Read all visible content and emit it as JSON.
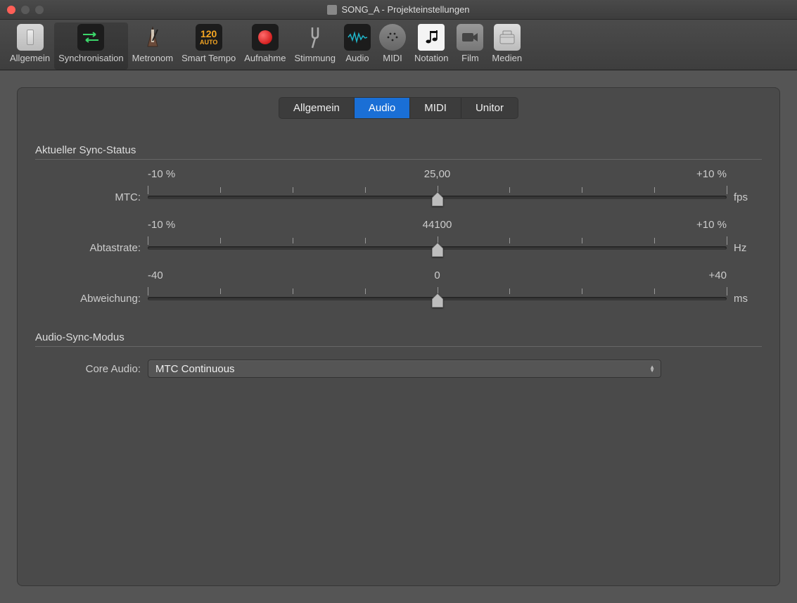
{
  "window": {
    "title": "SONG_A - Projekteinstellungen"
  },
  "toolbar": {
    "items": [
      {
        "label": "Allgemein"
      },
      {
        "label": "Synchronisation"
      },
      {
        "label": "Metronom"
      },
      {
        "label": "Smart Tempo"
      },
      {
        "label": "Aufnahme"
      },
      {
        "label": "Stimmung"
      },
      {
        "label": "Audio"
      },
      {
        "label": "MIDI"
      },
      {
        "label": "Notation"
      },
      {
        "label": "Film"
      },
      {
        "label": "Medien"
      }
    ],
    "active_index": 1
  },
  "tabs": {
    "items": [
      "Allgemein",
      "Audio",
      "MIDI",
      "Unitor"
    ],
    "active_index": 1
  },
  "section1": {
    "title": "Aktueller Sync-Status",
    "rows": [
      {
        "label": "MTC:",
        "min": "-10 %",
        "center": "25,00",
        "max": "+10 %",
        "unit": "fps"
      },
      {
        "label": "Abtastrate:",
        "min": "-10 %",
        "center": "44100",
        "max": "+10 %",
        "unit": "Hz"
      },
      {
        "label": "Abweichung:",
        "min": "-40",
        "center": "0",
        "max": "+40",
        "unit": "ms"
      }
    ]
  },
  "section2": {
    "title": "Audio-Sync-Modus",
    "core_audio_label": "Core Audio:",
    "core_audio_value": "MTC Continuous"
  },
  "icons": {
    "smart_tempo_num": "120",
    "smart_tempo_auto": "AUTO"
  }
}
